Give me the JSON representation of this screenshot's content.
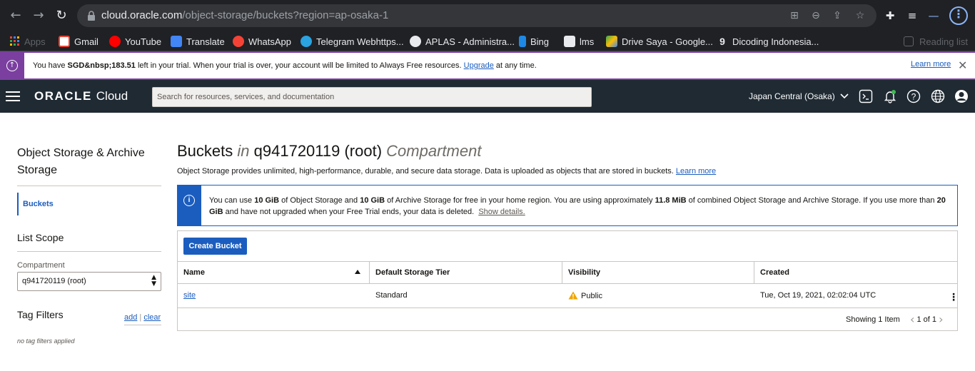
{
  "browser": {
    "url_host": "cloud.oracle.com",
    "url_path": "/object-storage/buckets?region=ap-osaka-1",
    "bookmarks": [
      {
        "label": "Apps"
      },
      {
        "label": "Gmail"
      },
      {
        "label": "YouTube"
      },
      {
        "label": "Translate"
      },
      {
        "label": "WhatsApp"
      },
      {
        "label": "Telegram Webhttps..."
      },
      {
        "label": "APLAS - Administra..."
      },
      {
        "label": "Bing"
      },
      {
        "label": "lms"
      },
      {
        "label": "Drive Saya - Google..."
      },
      {
        "label": "Dicoding Indonesia..."
      }
    ],
    "reading_list": "Reading list"
  },
  "trial": {
    "prefix": "You have ",
    "amount": "SGD&nbsp;183.51",
    "middle": " left in your trial. When your trial is over, your account will be limited to Always Free resources. ",
    "upgrade": "Upgrade",
    "suffix": " at any time.",
    "learn_more": "Learn more"
  },
  "header": {
    "logo_oracle": "ORACLE",
    "logo_cloud": "Cloud",
    "search_placeholder": "Search for resources, services, and documentation",
    "region": "Japan Central (Osaka)"
  },
  "sidebar": {
    "title": "Object Storage & Archive Storage",
    "active_item": "Buckets",
    "list_scope": "List Scope",
    "compartment_label": "Compartment",
    "compartment_value": "q941720119 (root)",
    "tag_filters": "Tag Filters",
    "add": "add",
    "clear": "clear",
    "no_tags": "no tag filters applied"
  },
  "main": {
    "title_main": "Buckets",
    "title_in": "in",
    "title_comp": "q941720119 (root)",
    "title_suffix": "Compartment",
    "description": "Object Storage provides unlimited, high-performance, durable, and secure data storage. Data is uploaded as objects that are stored in buckets.",
    "learn_more": "Learn more",
    "info": {
      "p1": "You can use ",
      "b1": "10 GiB",
      "p2": " of Object Storage and ",
      "b2": "10 GiB",
      "p3": " of Archive Storage for free in your home region. You are using approximately ",
      "b3": "11.8 MiB",
      "p4": " of combined Object Storage and Archive Storage. If you use more than ",
      "b4": "20 GiB",
      "p5": " and have not upgraded when your Free Trial ends, your data is deleted.",
      "show_details": "Show details."
    },
    "create_button": "Create Bucket",
    "columns": [
      "Name",
      "Default Storage Tier",
      "Visibility",
      "Created"
    ],
    "rows": [
      {
        "name": "site",
        "tier": "Standard",
        "visibility": "Public",
        "created": "Tue, Oct 19, 2021, 02:02:04 UTC"
      }
    ],
    "showing": "Showing 1 Item",
    "pager": "1 of 1"
  },
  "colors": {
    "oracle_header": "#1f2a33",
    "accent_blue": "#1b5dbf",
    "trial_purple": "#7b3fa0",
    "warning": "#f0a500"
  }
}
